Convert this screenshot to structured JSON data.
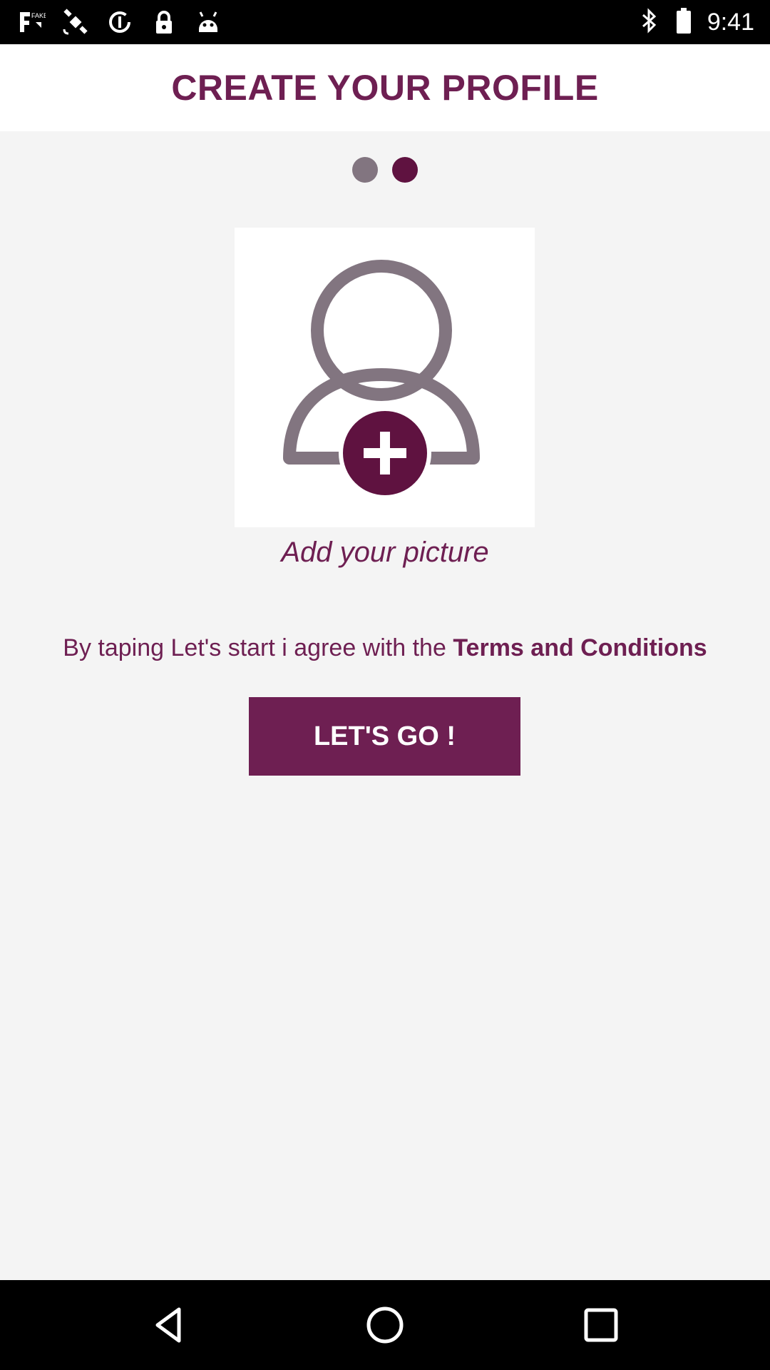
{
  "status_bar": {
    "time": "9:41",
    "left_icons": [
      "fake-gps-icon",
      "satellite-icon",
      "data-saver-icon",
      "lock-icon",
      "android-icon"
    ],
    "right_icons": [
      "bluetooth-icon",
      "battery-icon"
    ]
  },
  "header": {
    "title": "CREATE YOUR PROFILE"
  },
  "pager": {
    "count": 2,
    "active_index": 1
  },
  "avatar": {
    "icon": "add-user-icon"
  },
  "add_picture_label": "Add your picture",
  "terms": {
    "prefix": "By taping Let's start i agree with the ",
    "link": "Terms and Conditions"
  },
  "go_button_label": "LET'S GO !",
  "colors": {
    "brand": "#6e1f52",
    "dot_inactive": "#827580",
    "background": "#f4f4f4"
  },
  "nav_bar": {
    "icons": [
      "back-icon",
      "home-icon",
      "recents-icon"
    ]
  }
}
